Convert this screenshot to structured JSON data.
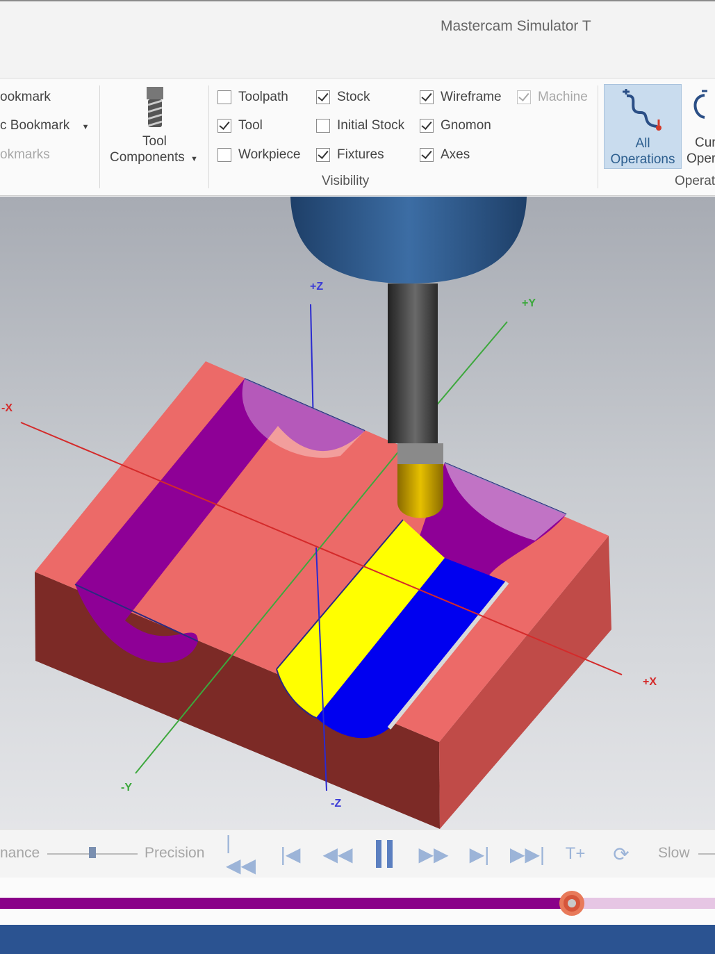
{
  "window": {
    "title": "Mastercam Simulator  T"
  },
  "ribbon": {
    "bookmarks": {
      "item1": "ookmark",
      "item2": "c Bookmark",
      "item3": "okmarks"
    },
    "tool_components": {
      "line1": "Tool",
      "line2": "Components"
    },
    "visibility": {
      "label": "Visibility",
      "options": [
        {
          "label": "Toolpath",
          "checked": false
        },
        {
          "label": "Tool",
          "checked": true
        },
        {
          "label": "Workpiece",
          "checked": false
        },
        {
          "label": "Stock",
          "checked": true
        },
        {
          "label": "Initial Stock",
          "checked": false
        },
        {
          "label": "Fixtures",
          "checked": true
        },
        {
          "label": "Wireframe",
          "checked": true
        },
        {
          "label": "Gnomon",
          "checked": true
        },
        {
          "label": "Axes",
          "checked": true
        },
        {
          "label": "Machine",
          "checked": true,
          "disabled": true
        }
      ]
    },
    "operations": {
      "all_line1": "All",
      "all_line2": "Operations",
      "current_line1": "Cur",
      "current_line2": "Oper",
      "group_label": "Operat"
    }
  },
  "viewport": {
    "axes": {
      "pz": "+Z",
      "py": "+Y",
      "mx": "-X",
      "px": "+X",
      "my": "-Y",
      "mz": "-Z"
    },
    "colors": {
      "stock_top": "#ec6a68",
      "stock_side": "#7c2a26",
      "stock_right": "#c04b48",
      "cut_surface": "#8e0096",
      "tool_cut": "#ffff00",
      "tool_cut2": "#0000f0",
      "holder": "#2d5a8e",
      "shank": "#3a3a3a",
      "tool_tip": "#d4a800"
    }
  },
  "playback": {
    "performance": "nance",
    "precision": "Precision",
    "slow": "Slow",
    "precision_slider_fraction": 0.5,
    "progress_fraction": 0.8
  }
}
